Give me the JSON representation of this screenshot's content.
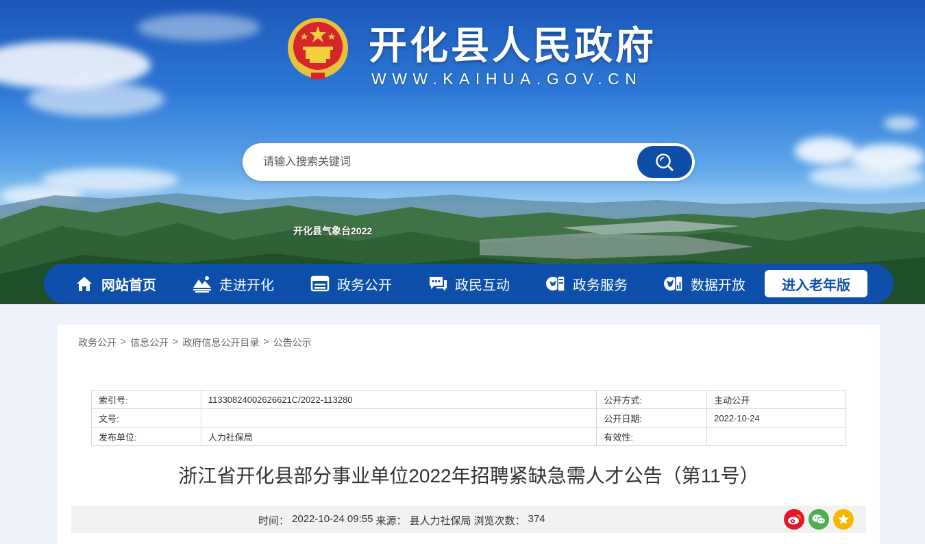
{
  "header": {
    "site_title": "开化县人民政府",
    "site_url": "WWW.KAIHUA.GOV.CN",
    "search_placeholder": "请输入搜索关键词",
    "ticker_text": "开化县气象台2022"
  },
  "nav": {
    "items": [
      {
        "label": "网站首页",
        "icon": "home-icon"
      },
      {
        "label": "走进开化",
        "icon": "landscape-icon"
      },
      {
        "label": "政务公开",
        "icon": "folder-icon"
      },
      {
        "label": "政民互动",
        "icon": "chat-icon"
      },
      {
        "label": "政务服务",
        "icon": "service-icon"
      },
      {
        "label": "数据开放",
        "icon": "data-icon"
      }
    ],
    "elder_label": "进入老年版"
  },
  "breadcrumb": {
    "items": [
      "政务公开",
      "信息公开",
      "政府信息公开目录",
      "公告公示"
    ],
    "separator": ">"
  },
  "meta": {
    "rows": [
      {
        "k1": "索引号:",
        "v1": "11330824002626621C/2022-113280",
        "k2": "公开方式:",
        "v2": "主动公开"
      },
      {
        "k1": "文号:",
        "v1": "",
        "k2": "公开日期:",
        "v2": "2022-10-24"
      },
      {
        "k1": "发布单位:",
        "v1": "人力社保局",
        "k2": "有效性:",
        "v2": ""
      }
    ]
  },
  "article": {
    "title": "浙江省开化县部分事业单位2022年招聘紧缺急需人才公告（第11号）",
    "time_label": "时间：",
    "time_value": "2022-10-24 09:55",
    "source_label": "来源：",
    "source_value": "县人力社保局",
    "views_label": "浏览次数：",
    "views_value": "374"
  },
  "share": {
    "icons": [
      "weibo-icon",
      "wechat-icon",
      "favorite-icon"
    ],
    "colors": {
      "weibo": "#e6162d",
      "wechat": "#4caf50",
      "favorite": "#f5b700"
    }
  },
  "colors": {
    "nav_bg": "#0d4fab",
    "search_btn": "#0e4ea8",
    "page_bg": "#eef3fb"
  }
}
